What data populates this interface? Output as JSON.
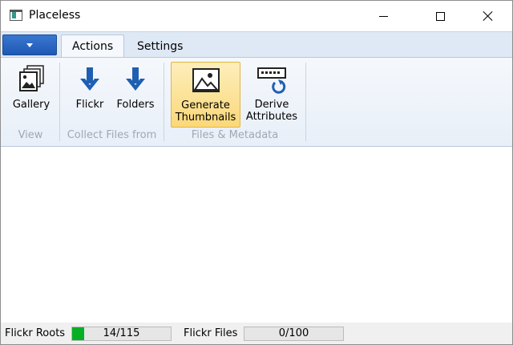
{
  "window": {
    "title": "Placeless",
    "icon": "app-window-icon"
  },
  "ribbon": {
    "tabs": [
      {
        "label": "Actions",
        "active": true
      },
      {
        "label": "Settings",
        "active": false
      }
    ],
    "groups": [
      {
        "label": "View",
        "buttons": [
          {
            "label": "Gallery",
            "icon": "gallery-icon"
          }
        ]
      },
      {
        "label": "Collect Files from",
        "buttons": [
          {
            "label": "Flickr",
            "icon": "arrow-down-icon"
          },
          {
            "label": "Folders",
            "icon": "arrow-down-icon"
          }
        ]
      },
      {
        "label": "Files & Metadata",
        "buttons": [
          {
            "label": "Generate Thumbnails",
            "icon": "image-icon",
            "highlighted": true
          },
          {
            "label": "Derive Attributes",
            "icon": "refresh-field-icon"
          }
        ]
      }
    ]
  },
  "status": {
    "flickr_roots_label": "Flickr Roots",
    "flickr_roots_text": "14/115",
    "flickr_roots_fraction": 0.1217,
    "flickr_files_label": "Flickr Files",
    "flickr_files_text": "0/100",
    "flickr_files_fraction": 0.0,
    "progress_color": "#06b025"
  },
  "colors": {
    "accent": "#1e58b3",
    "ribbon_bg": "#dfe9f5",
    "highlight": "#fbd879"
  }
}
